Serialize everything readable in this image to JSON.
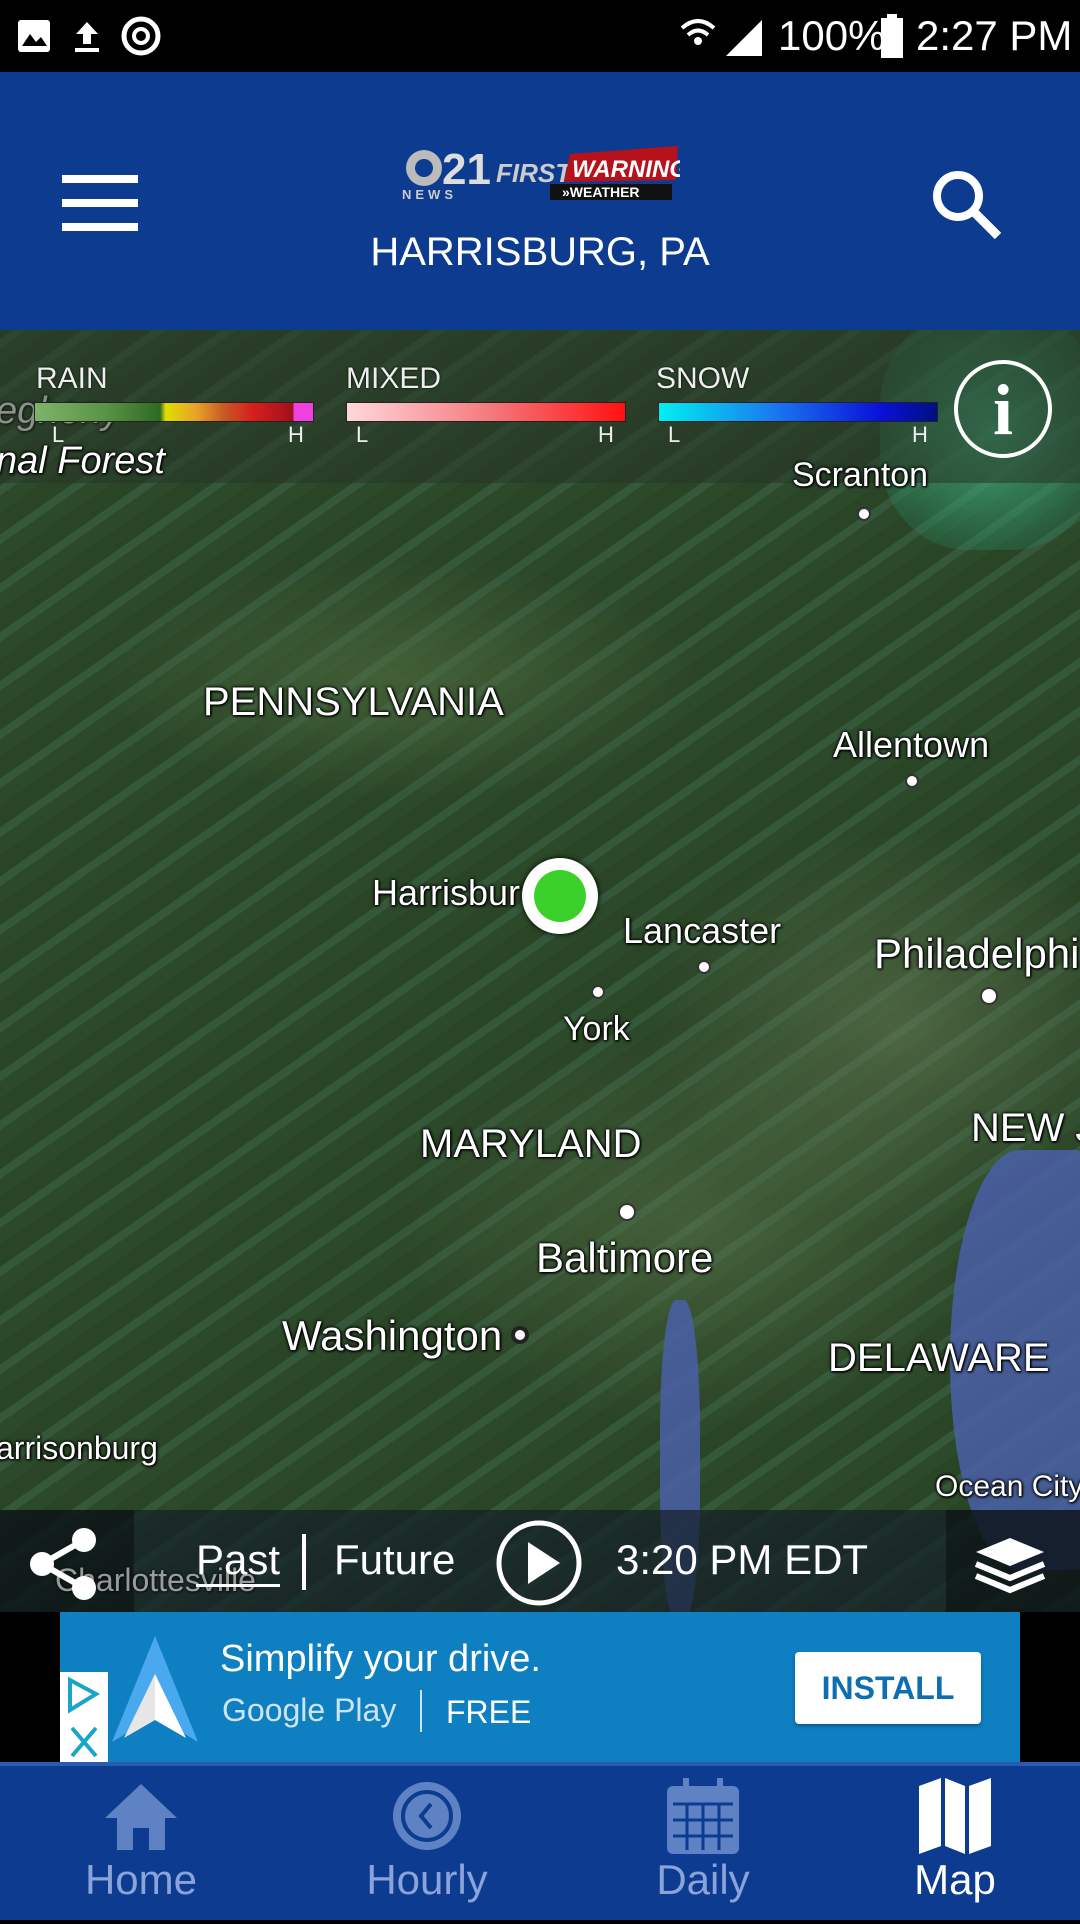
{
  "status_bar": {
    "battery": "100%",
    "time": "2:27 PM",
    "icons": [
      "image-icon",
      "upload-icon",
      "sync-icon",
      "wifi-icon",
      "signal-icon",
      "battery-icon"
    ]
  },
  "header": {
    "logo_text": "CBS 21 NEWS FIRST WARNING WEATHER",
    "location": "HARRISBURG, PA",
    "menu_icon": "hamburger-icon",
    "search_icon": "search-icon"
  },
  "legend": {
    "rain": {
      "label": "RAIN",
      "low": "L",
      "high": "H"
    },
    "mixed": {
      "label": "MIXED",
      "low": "L",
      "high": "H"
    },
    "snow": {
      "label": "SNOW",
      "low": "L",
      "high": "H"
    },
    "info_icon": "info-icon"
  },
  "map": {
    "labels": {
      "allegheny": "egheny",
      "forest": "nal Forest",
      "scranton": "Scranton",
      "pennsylvania": "PENNSYLVANIA",
      "allentown": "Allentown",
      "harrisburg": "Harrisbur",
      "lancaster": "Lancaster",
      "philadelphia": "Philadelphi",
      "york": "York",
      "new_jersey": "NEW J",
      "maryland": "MARYLAND",
      "baltimore": "Baltimore",
      "washington": "Washington",
      "delaware": "DELAWARE",
      "harrisonburg": "arrisonburg",
      "ocean_city": "Ocean City",
      "charlottesville": "Charlottesville"
    },
    "marker_color": "#3ad12a"
  },
  "controls": {
    "past": "Past",
    "future": "Future",
    "time": "3:20 PM EDT",
    "share_icon": "share-icon",
    "play_icon": "play-icon",
    "layers_icon": "layers-icon"
  },
  "ad": {
    "headline": "Simplify your drive.",
    "store": "Google Play",
    "price": "FREE",
    "install": "INSTALL"
  },
  "nav": [
    {
      "label": "Home",
      "icon": "home-icon"
    },
    {
      "label": "Hourly",
      "icon": "clock-icon"
    },
    {
      "label": "Daily",
      "icon": "calendar-icon"
    },
    {
      "label": "Map",
      "icon": "map-icon",
      "active": true
    }
  ],
  "colors": {
    "header": "#0c3b8f",
    "ad": "#0e7fc1",
    "install_text": "#0e6fb0"
  }
}
